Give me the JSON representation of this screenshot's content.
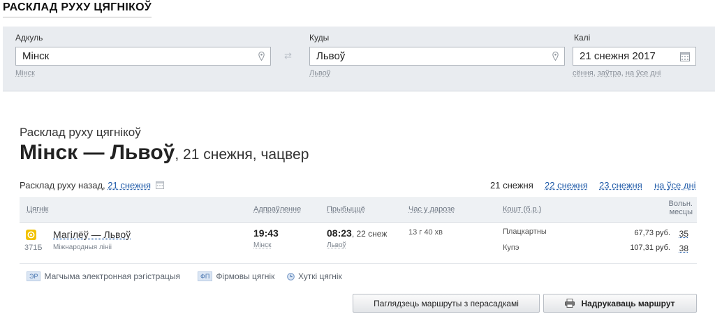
{
  "page_heading": "РАСКЛАД РУХУ ЦЯГНІКОЎ",
  "search": {
    "from": {
      "label": "Адкуль",
      "value": "Мінск",
      "hint": "Мінск",
      "icon": "map-pin-icon"
    },
    "to": {
      "label": "Куды",
      "value": "Львоў",
      "hint": "Львоў",
      "icon": "map-pin-icon"
    },
    "date": {
      "label": "Калі",
      "value": "21 снежня 2017",
      "icon": "calendar-icon",
      "hints": [
        "сёння",
        "заўтра",
        "на ўсе дні"
      ]
    },
    "swap_icon": "swap-arrows-icon",
    "swap_glyph": "⇄"
  },
  "result": {
    "subtitle": "Расклад руху цягнікоў",
    "route": "Мінск — Львоў",
    "date_line": ", 21 снежня, чацвер",
    "back_label": "Расклад руху назад,",
    "back_link": "21 снежня",
    "dates": {
      "current": "21 снежня",
      "next1": "22 снежня",
      "next2": "23 снежня",
      "all": "на ўсе дні"
    }
  },
  "table": {
    "headers": {
      "train": "Цягнік",
      "departure": "Адпраўленне",
      "arrival": "Прыбыццё",
      "duration": "Час у дарозе",
      "price": "Кошт (б.р.)",
      "seats_line1": "Вольн.",
      "seats_line2": "месцы"
    },
    "rows": [
      {
        "train_icon": "train-icon",
        "number": "371Б",
        "name": "Магілёў — Львоў",
        "category": "Міжнародныя лініі",
        "dep_time": "19:43",
        "dep_station": "Мінск",
        "arr_time": "08:23",
        "arr_date": ", 22 снеж",
        "arr_station": "Львоў",
        "duration": "13 г 40 хв",
        "classes": [
          {
            "name": "Плацкартны",
            "price": "67,73 руб.",
            "seats": "35"
          },
          {
            "name": "Купэ",
            "price": "107,31 руб.",
            "seats": "38"
          }
        ]
      }
    ]
  },
  "legend": {
    "er_badge": "ЭР",
    "er_label": "Магчыма электронная рэгістрацыя",
    "fp_badge": "ФП",
    "fp_label": "Фірмовы цягнік",
    "fast_icon": "clock-icon",
    "fast_label": "Хуткі цягнік"
  },
  "buttons": {
    "transfers": "Паглядзець маршруты з перасадкамі",
    "print": "Надрукаваць маршрут",
    "print_icon": "printer-icon"
  },
  "colors": {
    "link": "#1f5aa8",
    "panel": "#e9ecf0",
    "train_icon": "#f2c200"
  }
}
